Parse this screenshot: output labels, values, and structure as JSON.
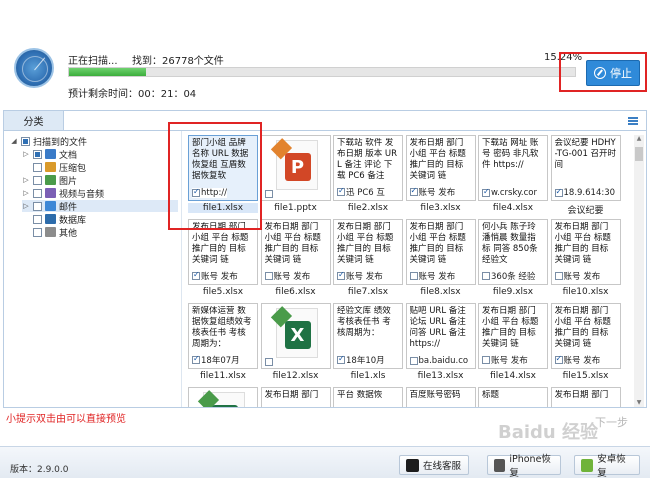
{
  "scan": {
    "status": "正在扫描...",
    "found": "找到：26778个文件",
    "percent_text": "15.24%",
    "progress": 0.1524,
    "remaining": "预计剩余时间：00：21：04",
    "stop_label": "停止"
  },
  "sidebar": {
    "tab_label": "分类",
    "root_label": "扫描到的文件",
    "items": [
      {
        "label": "文档",
        "icon": "document-icon",
        "color": "#3a7bc8",
        "expand": true
      },
      {
        "label": "压缩包",
        "icon": "archive-icon",
        "color": "#d99a2b",
        "expand": false
      },
      {
        "label": "图片",
        "icon": "image-icon",
        "color": "#4a9b4a",
        "expand": true
      },
      {
        "label": "视频与音频",
        "icon": "video-icon",
        "color": "#7b5fb5",
        "expand": true
      },
      {
        "label": "邮件",
        "icon": "mail-icon",
        "color": "#3d87d6",
        "expand": true
      },
      {
        "label": "数据库",
        "icon": "database-icon",
        "color": "#2d6cab",
        "expand": false
      },
      {
        "label": "其他",
        "icon": "other-icon",
        "color": "#8c8c8c",
        "expand": false
      }
    ]
  },
  "files": [
    {
      "name": "file1.xlsx",
      "text": "部门小组 品牌名称 URL 数据恢复组 互盾数据恢复软",
      "cb": "http://",
      "checked": true
    },
    {
      "name": "file1.pptx",
      "icon": "ppt"
    },
    {
      "name": "file2.xlsx",
      "text": "下载站 软件 发布日期 版本 URL 备注 评论 下载 PC6 备注",
      "cb": "迅 PC6 互",
      "checked": true
    },
    {
      "name": "file3.xlsx",
      "text": "发布日期 部门 小组 平台 标题 推广目的 目标关键词 链",
      "cb": "账号 发布",
      "checked": true
    },
    {
      "name": "file4.xlsx",
      "text": "下载站 网址 账号 密码 非凡软件 https://",
      "cb": "w.crsky.cor",
      "checked": true
    },
    {
      "name": "会议纪要",
      "text": "会议纪要 HDHY-TG-001 召开时间",
      "cb": "18.9.614:30",
      "checked": true
    },
    {
      "name": "file5.xlsx",
      "text": "发布日期 部门 小组 平台 标题 推广目的 目标关键词 链",
      "cb": "账号 发布",
      "checked": true
    },
    {
      "name": "file6.xlsx",
      "text": "发布日期 部门 小组 平台 标题 推广目的 目标关键词 链",
      "cb": "账号 发布",
      "checked": false
    },
    {
      "name": "file7.xlsx",
      "text": "发布日期 部门 小组 平台 标题 推广目的 目标关键词 链",
      "cb": "账号 发布",
      "checked": true
    },
    {
      "name": "file8.xlsx",
      "text": "发布日期 部门 小组 平台 标题 推广目的 目标关键词 链",
      "cb": "账号 发布",
      "checked": false
    },
    {
      "name": "file9.xlsx",
      "text": "何小兵 陈子玲 潘悄晨 数量指标 同答 850条 经验文",
      "cb": "360条 经验",
      "checked": false
    },
    {
      "name": "file10.xlsx",
      "text": "发布日期 部门 小组 平台 标题 推广目的 目标关键词 链",
      "cb": "账号 发布",
      "checked": false
    },
    {
      "name": "file11.xlsx",
      "text": "新媒体运营 数据恢复组绩效考核表任书 考核周期为：",
      "cb": "18年07月",
      "checked": true
    },
    {
      "name": "file12.xlsx",
      "icon": "xls"
    },
    {
      "name": "file1.xls",
      "text": "经验文库 绩效考核表任书 考核周期为：",
      "cb": "18年10月",
      "checked": true
    },
    {
      "name": "file13.xlsx",
      "text": "贴吧 URL 备注 论坛 URL 备注 问答 URL 备注 https://",
      "cb": "ba.baidu.co",
      "checked": false
    },
    {
      "name": "file14.xlsx",
      "text": "发布日期 部门 小组 平台 标题 推广目的 目标关键词 链",
      "cb": "账号 发布",
      "checked": false
    },
    {
      "name": "file15.xlsx",
      "text": "发布日期 部门 小组 平台 标题 推广目的 目标关键词 链",
      "cb": "账号 发布",
      "checked": true
    },
    {
      "name": "",
      "icon": "xls-partial"
    },
    {
      "name": "",
      "text": "发布日期 部门",
      "cb": "",
      "checked": false
    },
    {
      "name": "",
      "text": "平台 数据恢",
      "cb": "",
      "checked": false
    },
    {
      "name": "",
      "text": "百度账号密码",
      "cb": "",
      "checked": false
    },
    {
      "name": "",
      "text": "标题",
      "cb": "",
      "checked": false
    },
    {
      "name": "",
      "text": "发布日期 部门",
      "cb": "",
      "checked": false
    }
  ],
  "tip": "小提示双击由可以直接预览",
  "watermark": "Baidu 经验",
  "watermark_next": "下一步",
  "footer": {
    "version": "版本：2.9.0.0",
    "buttons": [
      {
        "label": "在线客服",
        "icon": "service-icon",
        "color": "#1d1d1d"
      },
      {
        "label": "iPhone恢复",
        "icon": "iphone-icon",
        "color": "#555555"
      },
      {
        "label": "安卓恢复",
        "icon": "android-icon",
        "color": "#6fb33a"
      }
    ]
  },
  "colors": {
    "accent": "#2f8ad9",
    "highlight": "#e02424",
    "progress": "#3cae3c"
  }
}
